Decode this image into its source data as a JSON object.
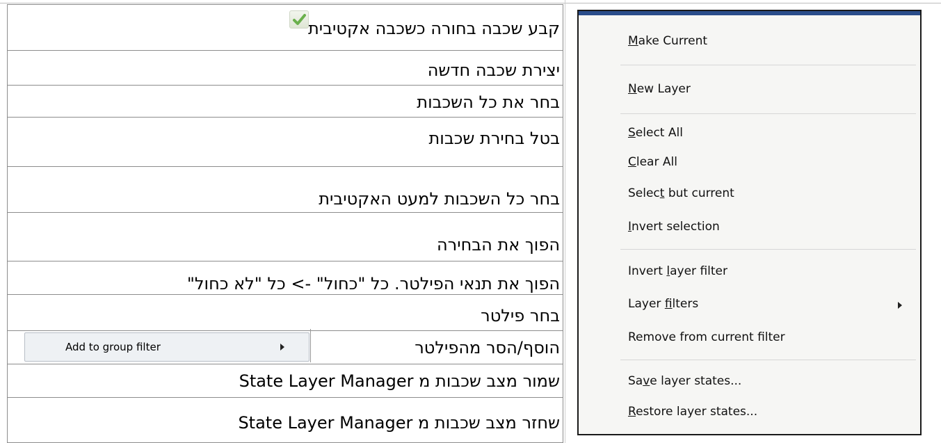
{
  "descriptions": [
    "קבע שכבה בחורה כשכבה אקטיבית",
    "יצירת שכבה חדשה",
    "בחר את כל השכבות",
    "בטל בחירת שכבות",
    "בחר כל השכבות למעט האקטיבית",
    "הפוך את הבחירה",
    "הפוך את תנאי הפילטר. כל \"כחול\" -> כל \"לא כחול\"",
    "בחר פילטר",
    "הוסף/הסר מהפילטר",
    "שמור מצב שכבות מ State Layer Manager",
    "שחזר מצב שכבות מ State Layer Manager"
  ],
  "context_menu": {
    "items": [
      {
        "pre": "",
        "u": "M",
        "post": "ake Current"
      },
      {
        "pre": "",
        "u": "N",
        "post": "ew Layer"
      },
      {
        "pre": "",
        "u": "S",
        "post": "elect All"
      },
      {
        "pre": "",
        "u": "C",
        "post": "lear All"
      },
      {
        "pre": "Selec",
        "u": "t",
        "post": " but current"
      },
      {
        "pre": "",
        "u": "I",
        "post": "nvert selection"
      },
      {
        "pre": "Invert ",
        "u": "l",
        "post": "ayer filter"
      },
      {
        "pre": "Layer ",
        "u": "f",
        "post": "ilters"
      },
      {
        "pre": "",
        "u": "",
        "post": "Remove from current filter"
      },
      {
        "pre": "Sa",
        "u": "v",
        "post": "e layer states..."
      },
      {
        "pre": "",
        "u": "R",
        "post": "estore layer states..."
      }
    ]
  },
  "submenu": {
    "label": "Add to group filter"
  },
  "colors": {
    "check": "#6ab04c",
    "menu_bg": "#f6f6f4",
    "submenu_bg": "#eef1f4"
  }
}
